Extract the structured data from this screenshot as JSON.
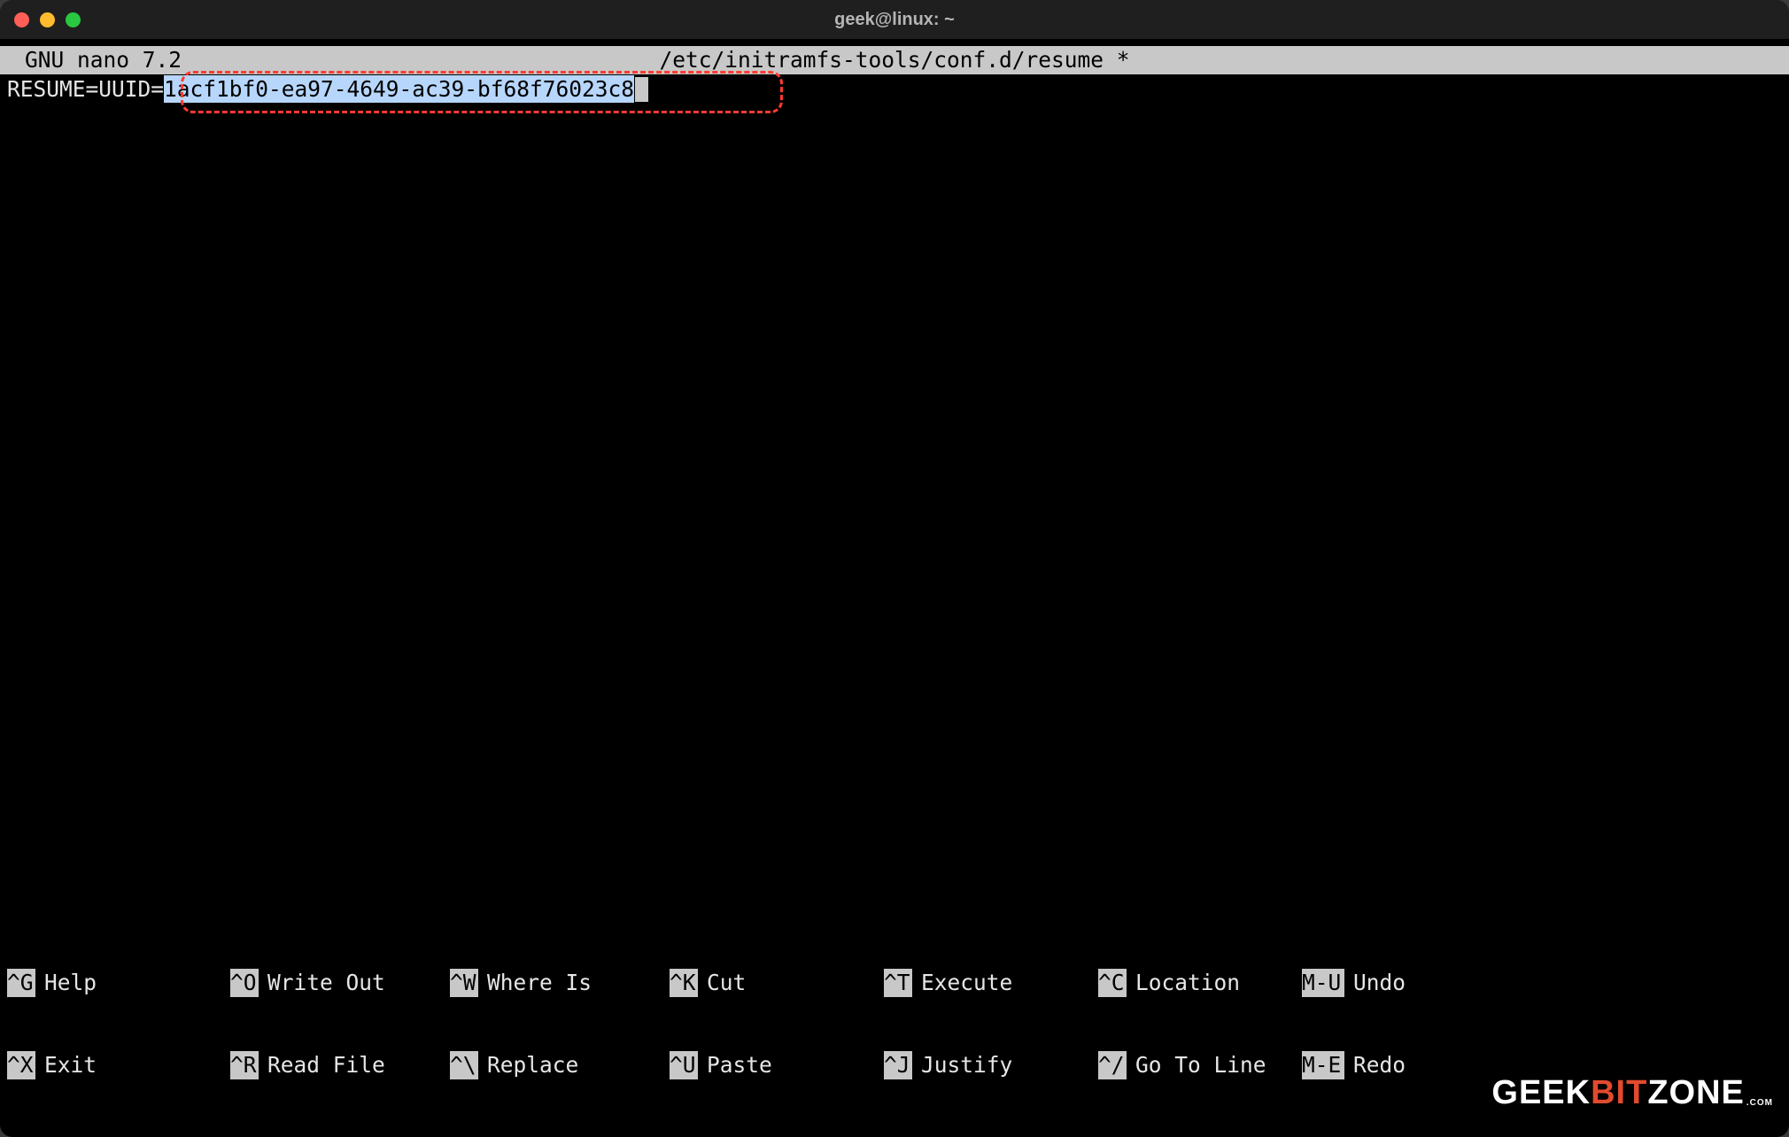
{
  "titlebar": {
    "title": "geek@linux: ~"
  },
  "nano": {
    "version_label": "GNU nano 7.2",
    "file_path": "/etc/initramfs-tools/conf.d/resume *"
  },
  "editor": {
    "prefix": "RESUME=UUID=",
    "uuid": "1acf1bf0-ea97-4649-ac39-bf68f76023c8"
  },
  "footer": {
    "row1": [
      {
        "key": "^G",
        "label": "Help"
      },
      {
        "key": "^O",
        "label": "Write Out"
      },
      {
        "key": "^W",
        "label": "Where Is"
      },
      {
        "key": "^K",
        "label": "Cut"
      },
      {
        "key": "^T",
        "label": "Execute"
      },
      {
        "key": "^C",
        "label": "Location"
      },
      {
        "key": "M-U",
        "label": "Undo"
      }
    ],
    "row2": [
      {
        "key": "^X",
        "label": "Exit"
      },
      {
        "key": "^R",
        "label": "Read File"
      },
      {
        "key": "^\\",
        "label": "Replace"
      },
      {
        "key": "^U",
        "label": "Paste"
      },
      {
        "key": "^J",
        "label": "Justify"
      },
      {
        "key": "^/",
        "label": "Go To Line"
      },
      {
        "key": "M-E",
        "label": "Redo"
      }
    ]
  },
  "watermark": {
    "part1": "GEEK",
    "part2": "BIT",
    "part3": "ZONE",
    "part4": ".COM"
  }
}
